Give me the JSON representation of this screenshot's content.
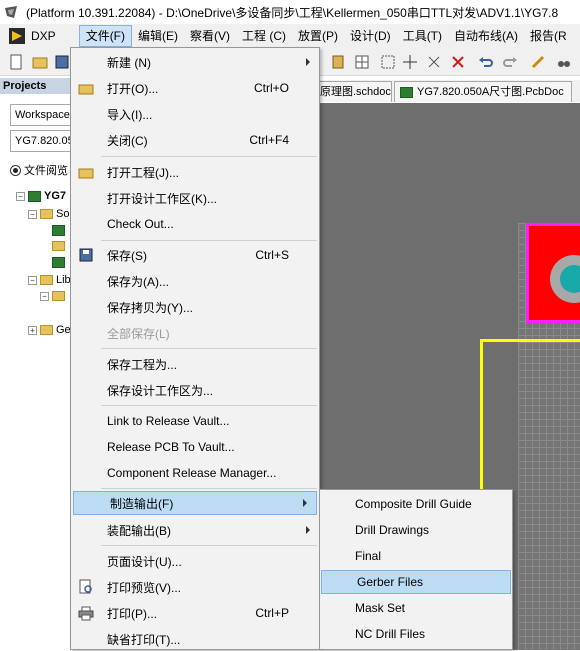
{
  "window": {
    "title": "(Platform 10.391.22084) - D:\\OneDrive\\多设备同步\\工程\\Kellermen_050串口TTL对发\\ADV1.1\\YG7.8"
  },
  "menubar": {
    "dxp": "DXP",
    "items": [
      "文件(F)",
      "编辑(E)",
      "察看(V)",
      "工程 (C)",
      "放置(P)",
      "设计(D)",
      "工具(T)",
      "自动布线(A)",
      "报告(R"
    ]
  },
  "left_panel": {
    "header": "Projects",
    "workspace_field": "Workspace",
    "project_field": "YG7.820.05",
    "radio_label": "文件阅览",
    "tree": [
      "YG7",
      "So",
      "",
      "",
      "",
      "Lib",
      "",
      "",
      "Ge"
    ]
  },
  "doc_tabs": [
    "原理图.schdoc",
    "YG7.820.050A尺寸图.PcbDoc"
  ],
  "file_menu": {
    "items": [
      {
        "label": "新建 (N)",
        "shortcut": "",
        "submenu": true,
        "icon": ""
      },
      {
        "label": "打开(O)...",
        "shortcut": "Ctrl+O",
        "submenu": false,
        "icon": "folder-open-icon"
      },
      {
        "label": "导入(I)...",
        "shortcut": "",
        "submenu": false,
        "icon": ""
      },
      {
        "label": "关闭(C)",
        "shortcut": "Ctrl+F4",
        "submenu": false,
        "icon": ""
      },
      {
        "label": "打开工程(J)...",
        "shortcut": "",
        "submenu": false,
        "icon": "folder-open-icon"
      },
      {
        "label": "打开设计工作区(K)...",
        "shortcut": "",
        "submenu": false,
        "icon": ""
      },
      {
        "label": "Check Out...",
        "shortcut": "",
        "submenu": false,
        "icon": ""
      },
      {
        "label": "保存(S)",
        "shortcut": "Ctrl+S",
        "submenu": false,
        "icon": "save-icon"
      },
      {
        "label": "保存为(A)...",
        "shortcut": "",
        "submenu": false,
        "icon": ""
      },
      {
        "label": "保存拷贝为(Y)...",
        "shortcut": "",
        "submenu": false,
        "icon": ""
      },
      {
        "label": "全部保存(L)",
        "shortcut": "",
        "submenu": false,
        "icon": "",
        "disabled": true
      },
      {
        "label": "保存工程为...",
        "shortcut": "",
        "submenu": false,
        "icon": ""
      },
      {
        "label": "保存设计工作区为...",
        "shortcut": "",
        "submenu": false,
        "icon": ""
      },
      {
        "label": "Link to Release Vault...",
        "shortcut": "",
        "submenu": false,
        "icon": ""
      },
      {
        "label": "Release PCB To Vault...",
        "shortcut": "",
        "submenu": false,
        "icon": ""
      },
      {
        "label": "Component Release Manager...",
        "shortcut": "",
        "submenu": false,
        "icon": ""
      },
      {
        "label": "制造输出(F)",
        "shortcut": "",
        "submenu": true,
        "icon": "",
        "highlighted": true
      },
      {
        "label": "装配输出(B)",
        "shortcut": "",
        "submenu": true,
        "icon": ""
      },
      {
        "label": "页面设计(U)...",
        "shortcut": "",
        "submenu": false,
        "icon": ""
      },
      {
        "label": "打印预览(V)...",
        "shortcut": "",
        "submenu": false,
        "icon": "print-preview-icon"
      },
      {
        "label": "打印(P)...",
        "shortcut": "Ctrl+P",
        "submenu": false,
        "icon": "printer-icon"
      },
      {
        "label": "缺省打印(T)...",
        "shortcut": "",
        "submenu": false,
        "icon": ""
      }
    ]
  },
  "fab_submenu": {
    "items": [
      "Composite Drill Guide",
      "Drill Drawings",
      "Final",
      "Gerber Files",
      "Mask Set",
      "NC Drill Files"
    ],
    "highlighted": "Gerber Files"
  },
  "colors": {
    "menu_highlight": "#bcdcf4",
    "canvas_bg": "#6e6e6e",
    "board_outline": "#ff20ff",
    "pad_fill": "#ff0000",
    "track": "#ffff00"
  }
}
